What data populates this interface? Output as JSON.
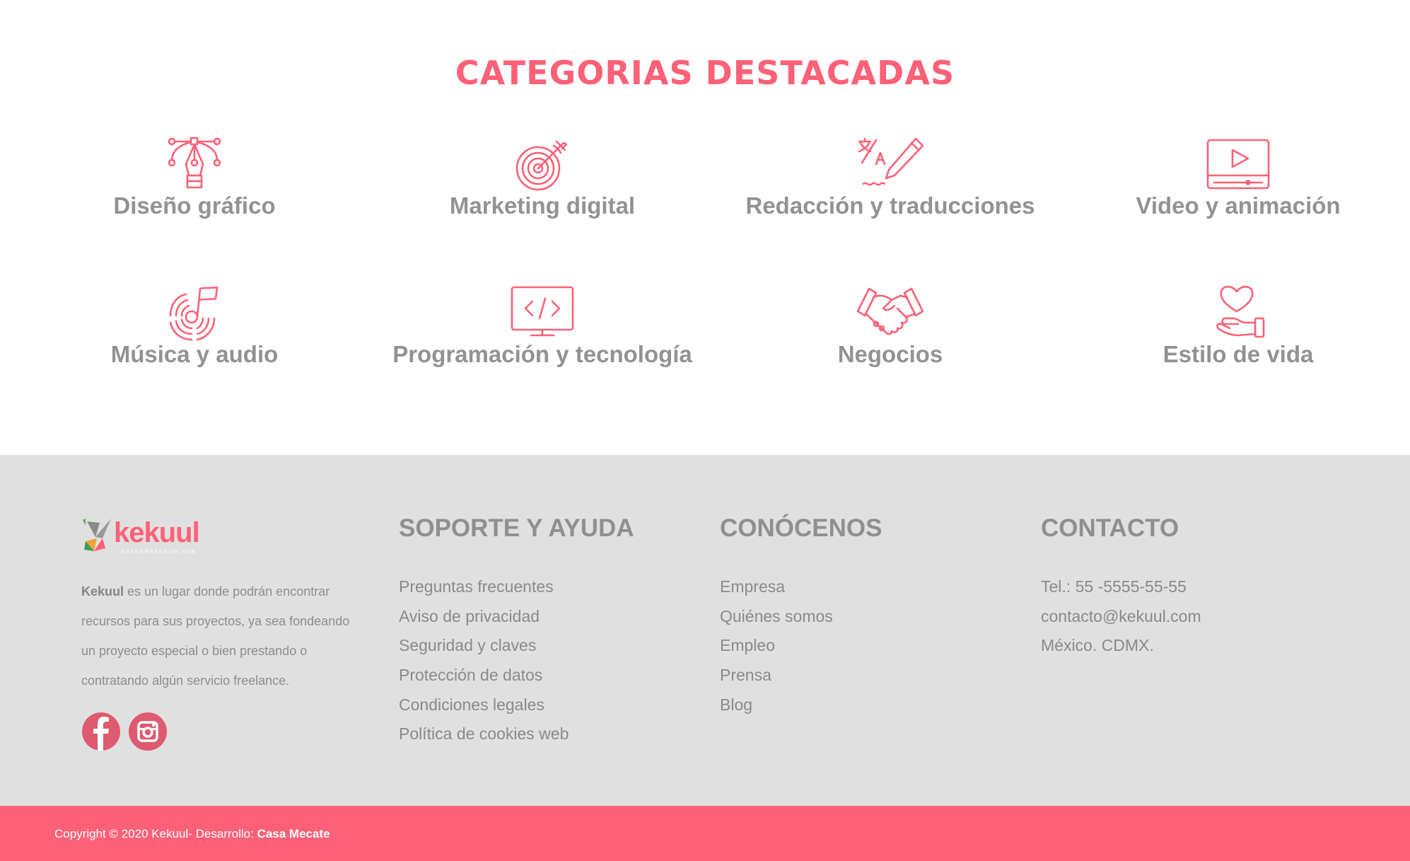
{
  "section_title": "CATEGORIAS DESTACADAS",
  "categories": [
    {
      "label": "Diseño gráfico",
      "icon": "pen-tool-icon"
    },
    {
      "label": "Marketing digital",
      "icon": "target-icon"
    },
    {
      "label": "Redacción y traducciones",
      "icon": "translate-pencil-icon"
    },
    {
      "label": "Video y animación",
      "icon": "video-player-icon"
    },
    {
      "label": "Música y audio",
      "icon": "music-note-icon"
    },
    {
      "label": "Programación y tecnología",
      "icon": "code-monitor-icon"
    },
    {
      "label": "Negocios",
      "icon": "handshake-icon"
    },
    {
      "label": "Estilo de vida",
      "icon": "heart-hand-icon"
    }
  ],
  "footer": {
    "logo_text": "kekuul",
    "logo_tagline": "ENTREPRENEUR HUB",
    "about_brand": "Kekuul",
    "about_text": " es un lugar donde podrán encontrar recursos para sus proyectos, ya sea fondeando un proyecto especial o bien prestando o contratando algún servicio freelance.",
    "social": [
      {
        "name": "facebook",
        "icon": "facebook-icon"
      },
      {
        "name": "instagram",
        "icon": "instagram-icon"
      }
    ],
    "columns": [
      {
        "heading": "SOPORTE Y AYUDA",
        "links": [
          "Preguntas frecuentes",
          "Aviso de privacidad",
          "Seguridad y claves",
          "Protección de datos",
          "Condiciones legales",
          "Política de cookies web"
        ]
      },
      {
        "heading": "CONÓCENOS",
        "links": [
          "Empresa",
          "Quiénes somos",
          "Empleo",
          "Prensa",
          "Blog"
        ]
      },
      {
        "heading": "CONTACTO",
        "links": [
          "Tel.: 55 -5555-55-55",
          "contacto@kekuul.com",
          "México. CDMX."
        ]
      }
    ]
  },
  "bottom_bar": {
    "copyright": "Copyright © 2020 Kekuul- Desarrollo: ",
    "developer": "Casa Mecate"
  },
  "colors": {
    "accent": "#fc6177",
    "footer_bg": "#e0e0e0",
    "text_gray": "#929292"
  }
}
